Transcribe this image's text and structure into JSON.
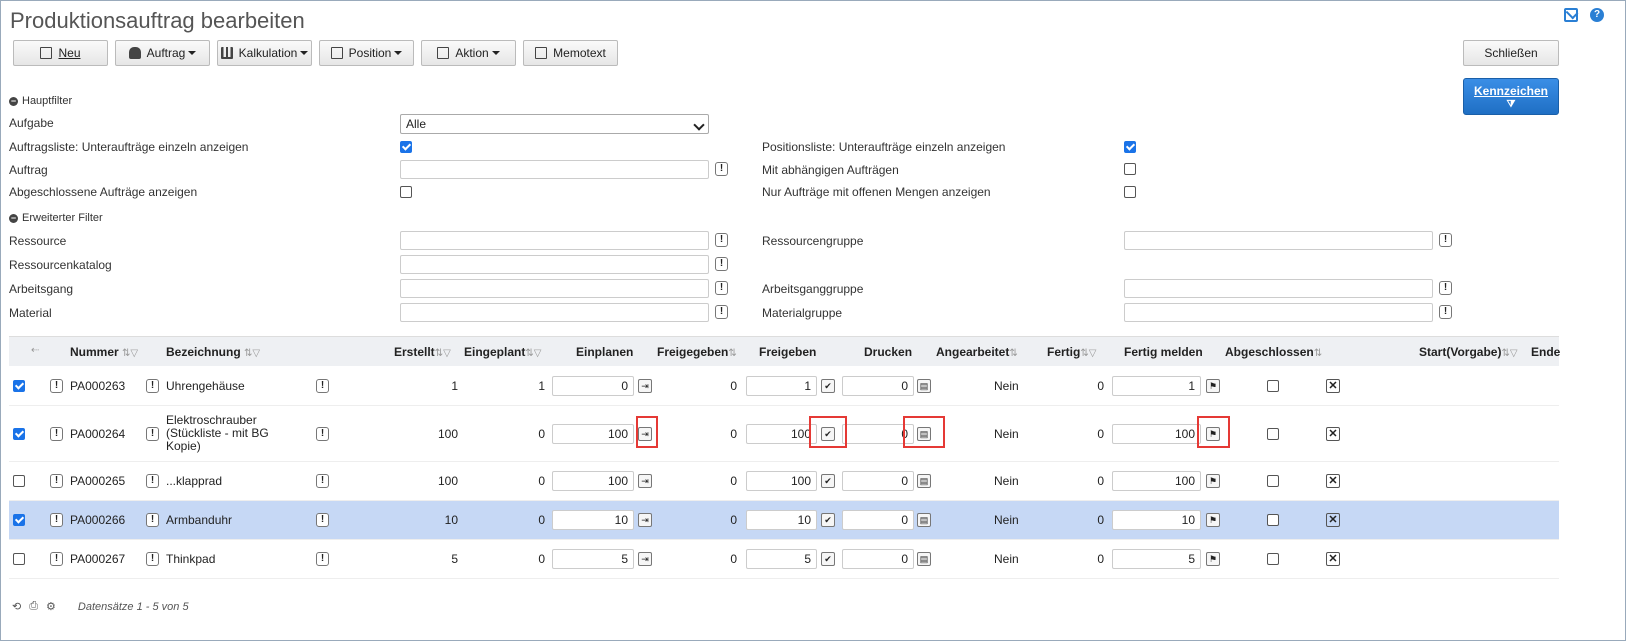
{
  "title": "Produktionsauftrag bearbeiten",
  "icons": {
    "mail": "mail-icon",
    "help": "help-icon"
  },
  "toolbar": {
    "neu": "Neu",
    "auftrag": "Auftrag",
    "kalkulation": "Kalkulation",
    "position": "Position",
    "aktion": "Aktion",
    "memotext": "Memotext",
    "schliessen": "Schließen",
    "kennzeichen": "Kennzeichen"
  },
  "hauptfilter": {
    "title": "Hauptfilter",
    "aufgabe_label": "Aufgabe",
    "aufgabe_value": "Alle",
    "auftragsliste_label": "Auftragsliste: Unteraufträge einzeln anzeigen",
    "auftragsliste_checked": true,
    "positionsliste_label": "Positionsliste: Unteraufträge einzeln anzeigen",
    "positionsliste_checked": true,
    "auftrag_label": "Auftrag",
    "abhaengig_label": "Mit abhängigen Aufträgen",
    "abhaengig_checked": false,
    "abgeschlossen_label": "Abgeschlossene Aufträge anzeigen",
    "abgeschlossen_checked": false,
    "offen_label": "Nur Aufträge mit offenen Mengen anzeigen",
    "offen_checked": false
  },
  "erweiterterfilter": {
    "title": "Erweiterter Filter",
    "ressource": "Ressource",
    "ressourcengruppe": "Ressourcengruppe",
    "ressourcenkatalog": "Ressourcenkatalog",
    "arbeitsgang": "Arbeitsgang",
    "arbeitsganggruppe": "Arbeitsganggruppe",
    "material": "Material",
    "materialgruppe": "Materialgruppe"
  },
  "grid": {
    "columns": {
      "nummer": "Nummer",
      "bezeichnung": "Bezeichnung",
      "erstellt": "Erstellt",
      "eingeplant": "Eingeplant",
      "einplanen": "Einplanen",
      "freigegeben": "Freigegeben",
      "freigeben": "Freigeben",
      "drucken": "Drucken",
      "angearbeitet": "Angearbeitet",
      "fertig": "Fertig",
      "fertig_melden": "Fertig melden",
      "abgeschlossen": "Abgeschlossen",
      "start": "Start(Vorgabe)",
      "ende": "Ende"
    },
    "rows": [
      {
        "checked": true,
        "nummer": "PA000263",
        "bez": [
          "Uhrengehäuse"
        ],
        "erstellt": "1",
        "eingeplant": "1",
        "einplanen": "0",
        "freigegeben": "0",
        "freigeben": "1",
        "drucken": "0",
        "angearbeitet": "Nein",
        "fertig": "0",
        "fertig_melden": "1",
        "selected": false
      },
      {
        "checked": true,
        "nummer": "PA000264",
        "bez": [
          "Elektroschrauber",
          "(Stückliste - mit BG",
          "Kopie)"
        ],
        "erstellt": "100",
        "eingeplant": "0",
        "einplanen": "100",
        "freigegeben": "0",
        "freigeben": "100",
        "drucken": "0",
        "angearbeitet": "Nein",
        "fertig": "0",
        "fertig_melden": "100",
        "selected": false
      },
      {
        "checked": false,
        "nummer": "PA000265",
        "bez": [
          "...klapprad"
        ],
        "erstellt": "100",
        "eingeplant": "0",
        "einplanen": "100",
        "freigegeben": "0",
        "freigeben": "100",
        "drucken": "0",
        "angearbeitet": "Nein",
        "fertig": "0",
        "fertig_melden": "100",
        "selected": false
      },
      {
        "checked": true,
        "nummer": "PA000266",
        "bez": [
          "Armbanduhr"
        ],
        "erstellt": "10",
        "eingeplant": "0",
        "einplanen": "10",
        "freigegeben": "0",
        "freigeben": "10",
        "drucken": "0",
        "angearbeitet": "Nein",
        "fertig": "0",
        "fertig_melden": "10",
        "selected": true
      },
      {
        "checked": false,
        "nummer": "PA000267",
        "bez": [
          "Thinkpad"
        ],
        "erstellt": "5",
        "eingeplant": "0",
        "einplanen": "5",
        "freigegeben": "0",
        "freigeben": "5",
        "drucken": "0",
        "angearbeitet": "Nein",
        "fertig": "0",
        "fertig_melden": "5",
        "selected": false
      }
    ]
  },
  "footer": {
    "info": "Datensätze 1 - 5 von 5"
  },
  "colors": {
    "accent": "#1f6fc4",
    "selected_row": "#c6d8f5",
    "highlight": "#e53935"
  }
}
